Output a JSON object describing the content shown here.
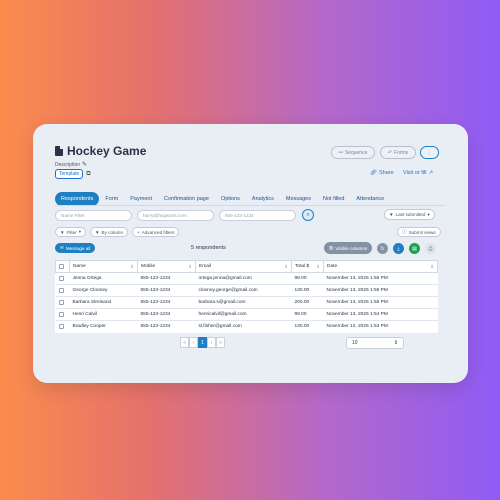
{
  "header": {
    "title": "Hockey Game",
    "description_label": "Description",
    "template_tag": "Template",
    "sequence_label": "Sequence",
    "forms_label": "Forms",
    "more_label": "⋮",
    "share_label": "Share",
    "visit_label": "Visit or fill"
  },
  "tabs": [
    {
      "label": "Respondents",
      "active": true
    },
    {
      "label": "Form"
    },
    {
      "label": "Payment"
    },
    {
      "label": "Confirmation page"
    },
    {
      "label": "Options"
    },
    {
      "label": "Analytics"
    },
    {
      "label": "Messages"
    },
    {
      "label": "Not filled"
    },
    {
      "label": "Attendance"
    }
  ],
  "filters": {
    "name_placeholder": "Name Filter",
    "email_placeholder": "harry@hogwarts.com",
    "phone_placeholder": "555-123-1234",
    "sort_label": "Last submitted",
    "filter_label": "Filter",
    "by_column_label": "By column",
    "advanced_label": "Advanced filters",
    "submit_label": "Submit views"
  },
  "actions": {
    "message_all": "Message all",
    "respondents_count": "5 respondents",
    "visible_columns": "Visible columns"
  },
  "table": {
    "columns": [
      "Name",
      "Mobile",
      "Email",
      "Total $",
      "Date"
    ],
    "rows": [
      [
        "Jenna Ortega",
        "555-123-1234",
        "ortega.jenna@gmail.com",
        "99.00",
        "November 13, 2025 1:56 PM"
      ],
      [
        "George Clooney",
        "555-123-1234",
        "clooney.george@gmail.com",
        "130.00",
        "November 13, 2025 1:56 PM"
      ],
      [
        "Barbara Streisand",
        "555-123-1234",
        "barbara.s@gmail.com",
        "200.00",
        "November 13, 2025 1:55 PM"
      ],
      [
        "Henri Calvil",
        "555-123-1234",
        "henricalvil@gmail.com",
        "99.00",
        "November 13, 2025 1:54 PM"
      ],
      [
        "Bradley Cooper",
        "555-123-1234",
        "sl.fisher@gmail.com",
        "130.00",
        "November 12, 2025 1:53 PM"
      ]
    ]
  },
  "pagination": {
    "first": "«",
    "prev": "‹",
    "current": "1",
    "next": "›",
    "last": "»",
    "per_page": "10"
  },
  "colors": {
    "accent": "#1e7fc3",
    "green": "#1aa34a"
  }
}
